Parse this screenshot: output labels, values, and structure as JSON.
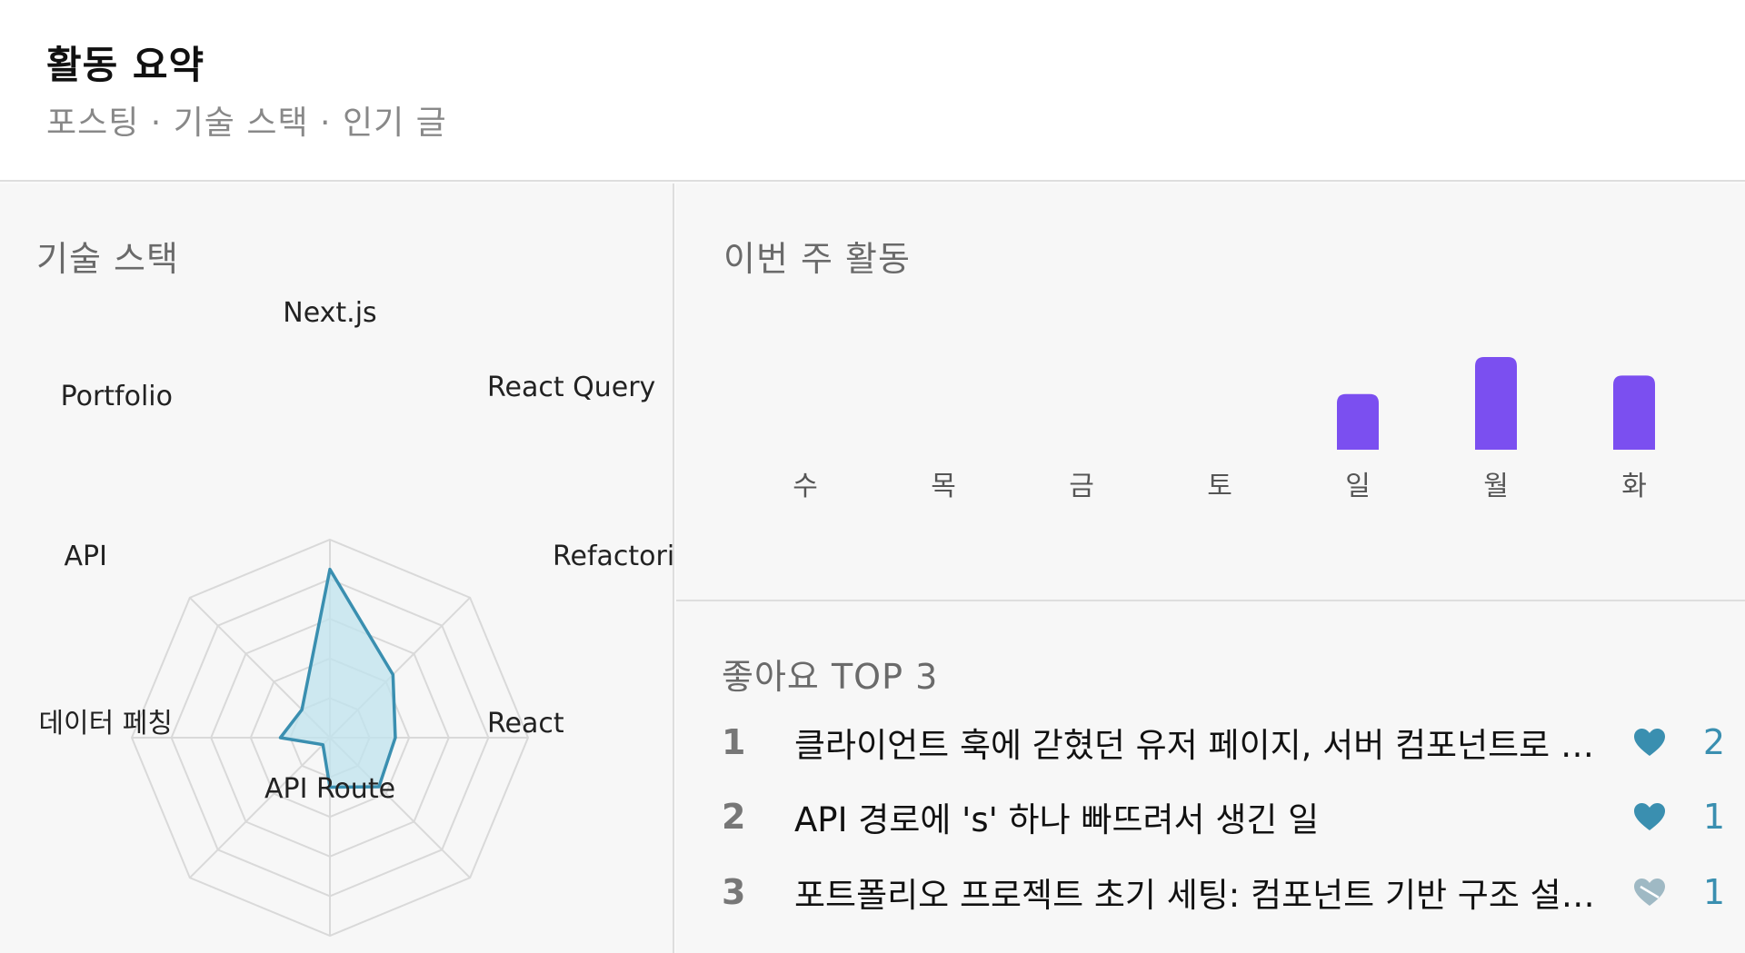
{
  "header": {
    "title": "활동 요약",
    "subtitle": "포스팅 · 기술 스택 · 인기 글"
  },
  "tech_stack": {
    "label": "기술 스택",
    "axes": [
      "Next.js",
      "React Query",
      "Refactoring",
      "React",
      "API Route",
      "데이터 페칭",
      "API",
      "Portfolio"
    ],
    "values": [
      0.85,
      0.45,
      0.33,
      0.35,
      0.25,
      0.05,
      0.25,
      0.2
    ],
    "colors": {
      "fill": "#bfe3ee",
      "stroke": "#3a8fb0",
      "grid": "#d9d9d9"
    }
  },
  "activity": {
    "label": "이번 주 활동",
    "days": [
      "수",
      "목",
      "금",
      "토",
      "일",
      "월",
      "화"
    ],
    "values": [
      0,
      0,
      0,
      0,
      3,
      5,
      4
    ],
    "bar_color": "#7b4ff0"
  },
  "top_liked": {
    "label": "좋아요 TOP 3",
    "items": [
      {
        "rank": "1",
        "title": "클라이언트 훅에 갇혔던 유저 페이지, 서버 컴포넌트로 구...",
        "likes": "2",
        "icon": "heart-icon"
      },
      {
        "rank": "2",
        "title": "API 경로에 's' 하나 빠뜨려서 생긴 일",
        "likes": "1",
        "icon": "heart-icon"
      },
      {
        "rank": "3",
        "title": "포트폴리오 프로젝트 초기 세팅: 컴포넌트 기반 구조 설계기",
        "likes": "1",
        "icon": "heart-icon"
      }
    ],
    "heart_color": "#3a8fb0"
  }
}
